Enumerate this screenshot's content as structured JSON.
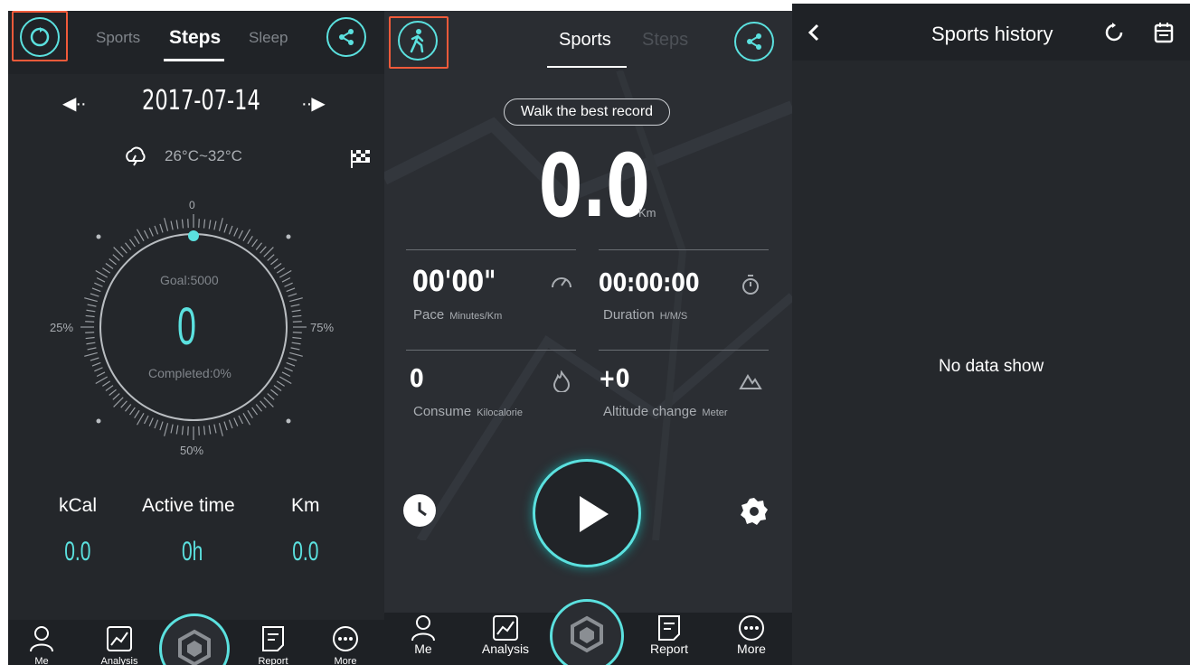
{
  "steps_screen": {
    "tabs": [
      {
        "label": "Sports",
        "active": false
      },
      {
        "label": "Steps",
        "active": true
      },
      {
        "label": "Sleep",
        "active": false
      }
    ],
    "date": "2017-07-14",
    "prev_arrow": "◀··",
    "next_arrow": "··▶",
    "weather": "26°C~32°C",
    "dial": {
      "tick_top": "0",
      "tick_left": "25%",
      "tick_right": "75%",
      "tick_bottom": "50%",
      "goal": "Goal:5000",
      "value": "0",
      "completed": "Completed:0%"
    },
    "stats": {
      "kcal_label": "kCal",
      "active_label": "Active time",
      "km_label": "Km",
      "kcal_value": "0.0",
      "active_value": "0h",
      "km_value": "0.0"
    },
    "nav": {
      "me": "Me",
      "analysis": "Analysis",
      "report": "Report",
      "more": "More"
    }
  },
  "sports_screen": {
    "tabs": [
      {
        "label": "Sports",
        "active": true
      },
      {
        "label": "Steps",
        "active": false
      }
    ],
    "best_record_button": "Walk the best record",
    "distance_value": "0.0",
    "distance_unit": "Km",
    "pace_value": "00'00\"",
    "pace_label": "Pace",
    "pace_unit": "Minutes/Km",
    "duration_value": "00:00:00",
    "duration_label": "Duration",
    "duration_unit": "H/M/S",
    "consume_value": "0",
    "consume_label": "Consume",
    "consume_unit": "Kilocalorie",
    "altitude_value": "+0",
    "altitude_label": "Altitude change",
    "altitude_unit": "Meter",
    "nav": {
      "me": "Me",
      "analysis": "Analysis",
      "report": "Report",
      "more": "More"
    }
  },
  "history_screen": {
    "title": "Sports history",
    "empty_message": "No data show"
  },
  "colors": {
    "accent": "#5be1df",
    "highlight": "#f05a3a"
  }
}
